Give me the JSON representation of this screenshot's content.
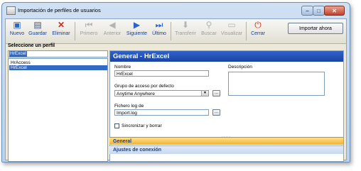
{
  "window": {
    "title": "Importación de perfiles de usuarios"
  },
  "toolbar": {
    "items": [
      {
        "label": "Nuevo",
        "icon": "new-icon",
        "enabled": true
      },
      {
        "label": "Guardar",
        "icon": "save-icon",
        "enabled": true
      },
      {
        "label": "Eliminar",
        "icon": "delete-icon",
        "enabled": true
      },
      {
        "label": "Primero",
        "icon": "first-icon",
        "enabled": false
      },
      {
        "label": "Anterior",
        "icon": "previous-icon",
        "enabled": false
      },
      {
        "label": "Siguiente",
        "icon": "next-icon",
        "enabled": true
      },
      {
        "label": "Último",
        "icon": "last-icon",
        "enabled": true
      },
      {
        "label": "Transferir",
        "icon": "transfer-icon",
        "enabled": false
      },
      {
        "label": "Buscar",
        "icon": "search-icon",
        "enabled": false
      },
      {
        "label": "Visualizar",
        "icon": "view-icon",
        "enabled": false
      },
      {
        "label": "Cerrar",
        "icon": "close-icon",
        "enabled": true
      }
    ],
    "import_button": "Importar ahora"
  },
  "left_panel": {
    "label": "Seleccione un perfil",
    "search_value": "HrExcel",
    "profiles": [
      "HrAccess",
      "HrExcel"
    ],
    "selected": "HrExcel"
  },
  "detail": {
    "header": "General - HrExcel",
    "nombre_label": "Nombre",
    "nombre_value": "HrExcel",
    "grupo_label": "Grupo de acceso por defecto",
    "grupo_value": "Anytime Anywhere",
    "fichero_label": "Fichero log de",
    "fichero_value": "Import.log",
    "sincronizar_label": "Sincronizar y borrar",
    "sincronizar_checked": false,
    "descripcion_label": "Descripción",
    "ellipsis": "...",
    "grip": "....."
  },
  "sections": {
    "general": "General",
    "conexion": "Ajustes de conexión"
  },
  "colors": {
    "header_blue": "#1f4fb8",
    "selection_blue": "#316ac5",
    "section_orange": "#f1b330",
    "close_red": "#c3422b"
  }
}
